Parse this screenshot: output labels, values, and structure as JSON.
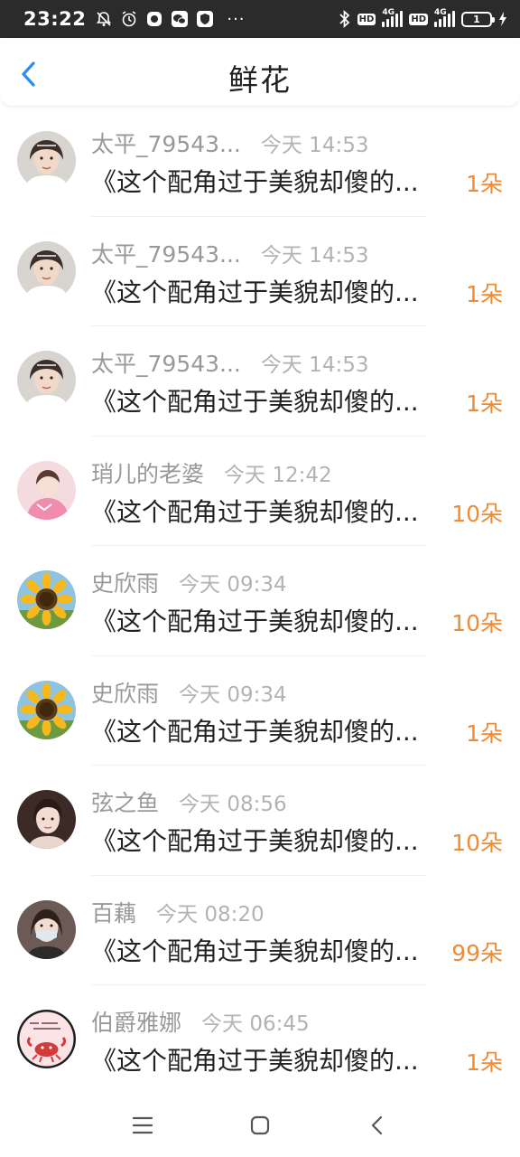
{
  "status_bar": {
    "time": "23:22",
    "network_label_1": "4G",
    "network_label_2": "4G",
    "hd_1": "HD",
    "hd_2": "HD",
    "battery": "1",
    "dots": "···"
  },
  "header": {
    "title": "鲜花"
  },
  "colors": {
    "accent": "#2a8df0",
    "count": "#f08a33",
    "name": "#999999",
    "time": "#b3b3b3",
    "text": "#222222"
  },
  "items": [
    {
      "name": "太平_79543...",
      "time": "今天 14:53",
      "text": "《这个配角过于美貌却傻的...",
      "count": "1朵",
      "avatar": "girl-portrait"
    },
    {
      "name": "太平_79543...",
      "time": "今天 14:53",
      "text": "《这个配角过于美貌却傻的...",
      "count": "1朵",
      "avatar": "girl-portrait"
    },
    {
      "name": "太平_79543...",
      "time": "今天 14:53",
      "text": "《这个配角过于美貌却傻的...",
      "count": "1朵",
      "avatar": "girl-portrait"
    },
    {
      "name": "琑儿的老婆",
      "time": "今天 12:42",
      "text": "《这个配角过于美貌却傻的...",
      "count": "10朵",
      "avatar": "pink-girl"
    },
    {
      "name": "史欣雨",
      "time": "今天 09:34",
      "text": "《这个配角过于美貌却傻的...",
      "count": "10朵",
      "avatar": "sunflower"
    },
    {
      "name": "史欣雨",
      "time": "今天 09:34",
      "text": "《这个配角过于美貌却傻的...",
      "count": "1朵",
      "avatar": "sunflower"
    },
    {
      "name": "弦之鱼",
      "time": "今天 08:56",
      "text": "《这个配角过于美貌却傻的...",
      "count": "10朵",
      "avatar": "dark-hair-girl"
    },
    {
      "name": "百藕",
      "time": "今天 08:20",
      "text": "《这个配角过于美貌却傻的...",
      "count": "99朵",
      "avatar": "masked-girl"
    },
    {
      "name": "伯爵雅娜",
      "time": "今天 06:45",
      "text": "《这个配角过于美貌却傻的...",
      "count": "1朵",
      "avatar": "cartoon-crab"
    }
  ]
}
